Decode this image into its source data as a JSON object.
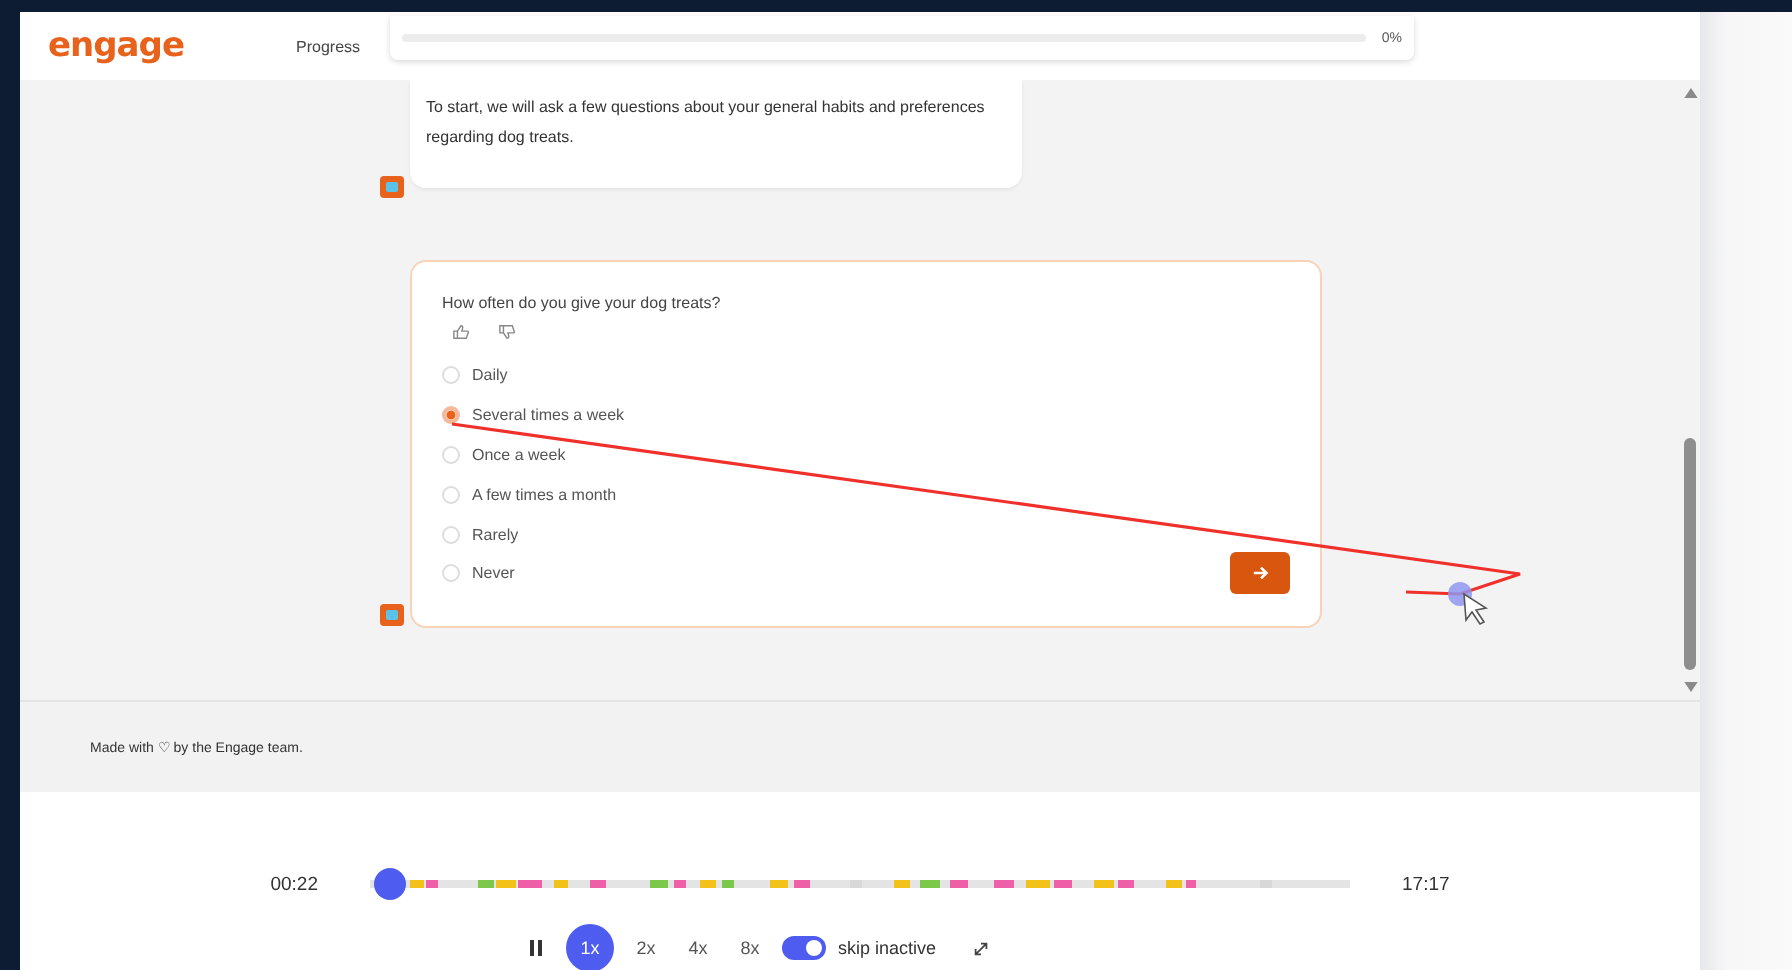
{
  "header": {
    "logo": "engage",
    "progress_label": "Progress",
    "progress": {
      "level": 0,
      "reading": "0%"
    }
  },
  "chat": [
    {
      "kind": "message",
      "text": "To start, we will ask a few questions about your general habits and preferences regarding dog treats."
    },
    {
      "kind": "question",
      "text": "How often do you give your dog treats?",
      "options": [
        {
          "label": "Daily",
          "selected": false
        },
        {
          "label": "Several times a week",
          "selected": true
        },
        {
          "label": "Once a week",
          "selected": false
        },
        {
          "label": "A few times a month",
          "selected": false
        },
        {
          "label": "Rarely",
          "selected": false
        },
        {
          "label": "Never",
          "selected": false
        }
      ]
    }
  ],
  "footer": {
    "text": "Made with ♡ by the Engage team."
  },
  "player": {
    "current_time": "00:22",
    "total_time": "17:17",
    "timeline": {
      "level": 0.021
    },
    "speeds": [
      {
        "label": "1x",
        "selected": true
      },
      {
        "label": "2x",
        "selected": false
      },
      {
        "label": "4x",
        "selected": false
      },
      {
        "label": "8x",
        "selected": false
      }
    ],
    "skip_inactive": {
      "label": "skip inactive",
      "on": true
    }
  }
}
